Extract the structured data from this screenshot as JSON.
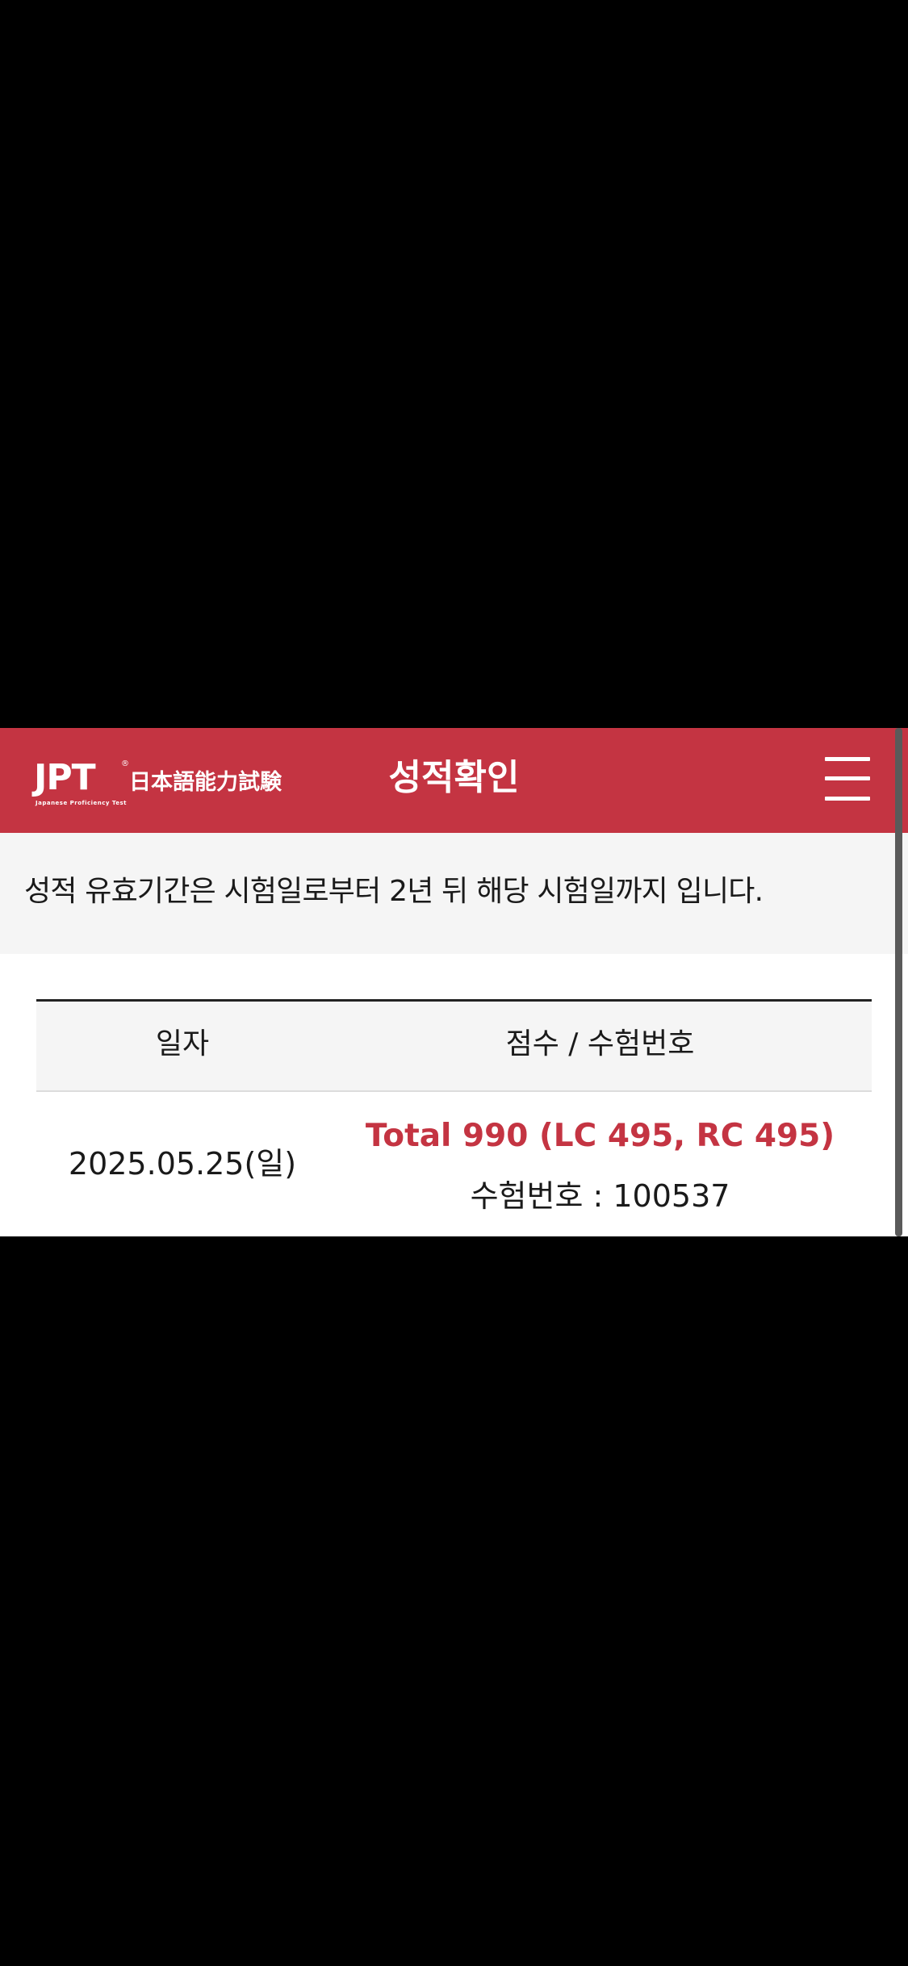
{
  "header": {
    "logo_text": "JPT",
    "logo_registered": "®",
    "logo_kanji": "日本語能力試験",
    "logo_subtitle": "Japanese Proficiency Test",
    "title": "성적확인",
    "menu_icon": "hamburger-menu-icon"
  },
  "notice": {
    "text": "성적 유효기간은 시험일로부터 2년 뒤 해당 시험일까지 입니다."
  },
  "table": {
    "headers": {
      "date": "일자",
      "score": "점수 / 수험번호"
    },
    "rows": [
      {
        "date": "2025.05.25(일)",
        "score": "Total 990 (LC 495, RC 495)",
        "exam_number": "수험번호 : 100537"
      }
    ]
  },
  "colors": {
    "brand": "#c43442",
    "notice_bg": "#f5f5f5",
    "text": "#1a1a1a"
  }
}
